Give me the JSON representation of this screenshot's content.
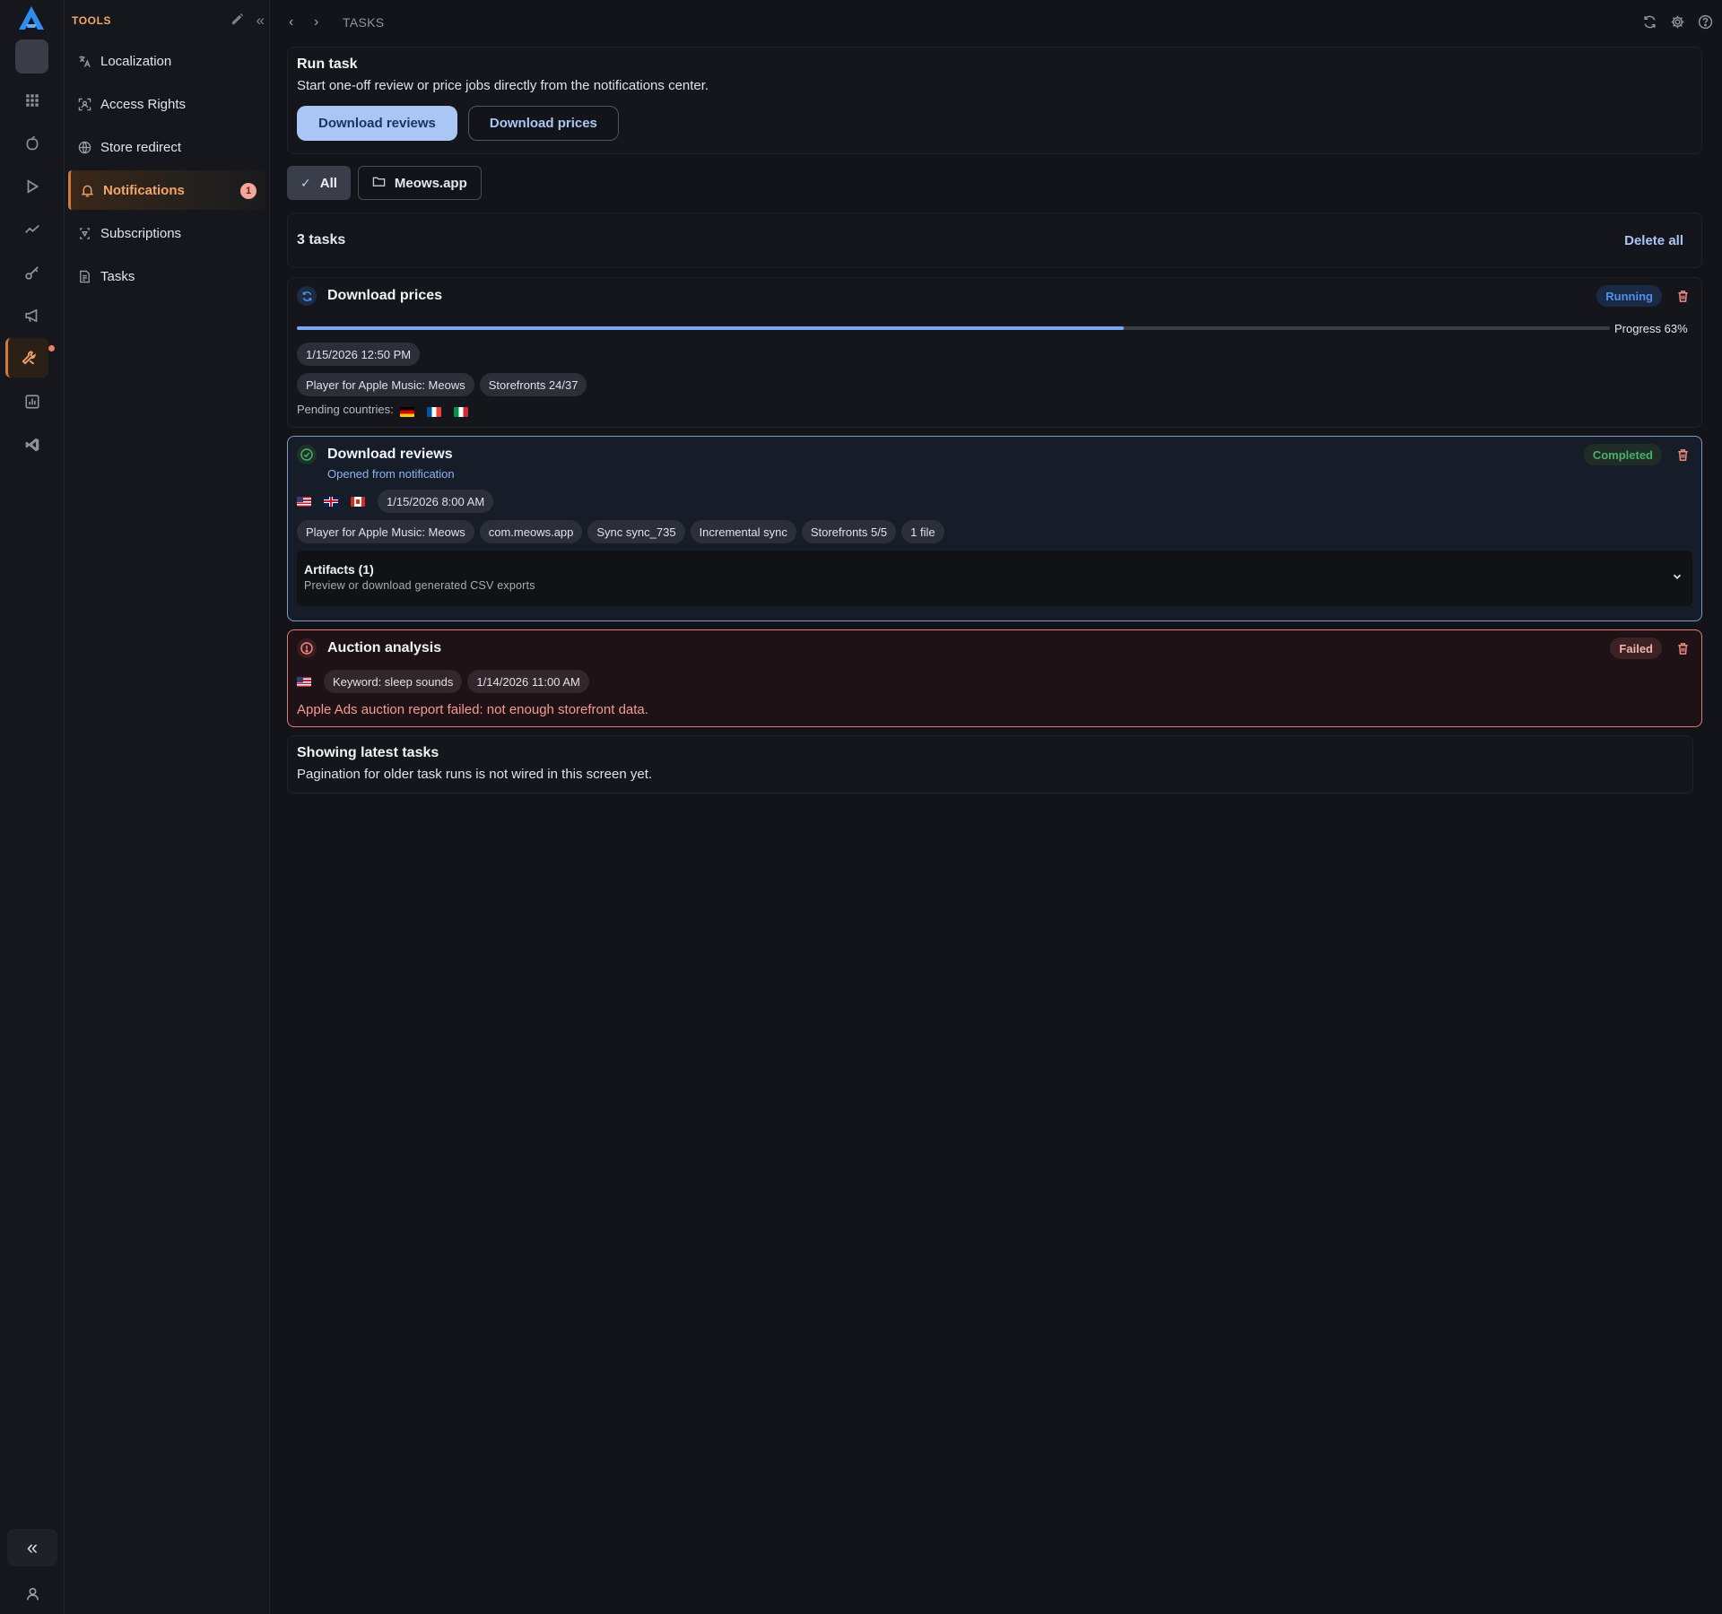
{
  "sidebar": {
    "section_title": "TOOLS",
    "items": [
      {
        "label": "Localization",
        "icon": "translate-icon"
      },
      {
        "label": "Access Rights",
        "icon": "access-icon"
      },
      {
        "label": "Store redirect",
        "icon": "globe-icon"
      },
      {
        "label": "Notifications",
        "icon": "bell-icon",
        "badge": "1",
        "active": true
      },
      {
        "label": "Subscriptions",
        "icon": "subscriptions-icon"
      },
      {
        "label": "Tasks",
        "icon": "tasks-icon"
      }
    ]
  },
  "rail": {
    "icons": [
      "grid-icon",
      "apple-icon",
      "play-icon",
      "trend-icon",
      "key-icon",
      "megaphone-icon",
      "tools-icon",
      "chart-icon",
      "vscode-icon"
    ],
    "collapse_label": "«"
  },
  "header": {
    "breadcrumb": "TASKS"
  },
  "run_task": {
    "title": "Run task",
    "subtitle": "Start one-off review or price jobs directly from the notifications center.",
    "btn_reviews": "Download reviews",
    "btn_prices": "Download prices"
  },
  "filters": {
    "all": "All",
    "app": "Meows.app"
  },
  "tasks_header": {
    "count": "3 tasks",
    "delete_all": "Delete all"
  },
  "tasks": [
    {
      "title": "Download prices",
      "status": "Running",
      "progress_label": "Progress 63%",
      "progress": 0.63,
      "date": "1/15/2026 12:50 PM",
      "app": "Player for Apple Music: Meows",
      "storefronts": "Storefronts 24/37",
      "pending_label": "Pending countries:",
      "pending_flags": [
        "DE",
        "FR",
        "IT"
      ]
    },
    {
      "title": "Download reviews",
      "status": "Completed",
      "opened_from": "Opened from notification",
      "flags": [
        "US",
        "GB",
        "CA"
      ],
      "date": "1/15/2026 8:00 AM",
      "app": "Player for Apple Music: Meows",
      "bundle": "com.meows.app",
      "sync": "Sync sync_735",
      "sync_type": "Incremental sync",
      "storefronts": "Storefronts 5/5",
      "files": "1 file",
      "artifacts_title": "Artifacts (1)",
      "artifacts_sub": "Preview or download generated CSV exports"
    },
    {
      "title": "Auction analysis",
      "status": "Failed",
      "flags": [
        "US"
      ],
      "keyword": "Keyword: sleep sounds",
      "date": "1/14/2026 11:00 AM",
      "error": "Apple Ads auction report failed: not enough storefront data."
    }
  ],
  "footer_info": {
    "title": "Showing latest tasks",
    "text": "Pagination for older task runs is not wired in this screen yet."
  },
  "colors": {
    "accent_orange": "#f3a66c",
    "accent_blue": "#a9c6f4",
    "running": "#4f8fe8",
    "completed": "#4cae6a",
    "failed": "#f28b82"
  }
}
